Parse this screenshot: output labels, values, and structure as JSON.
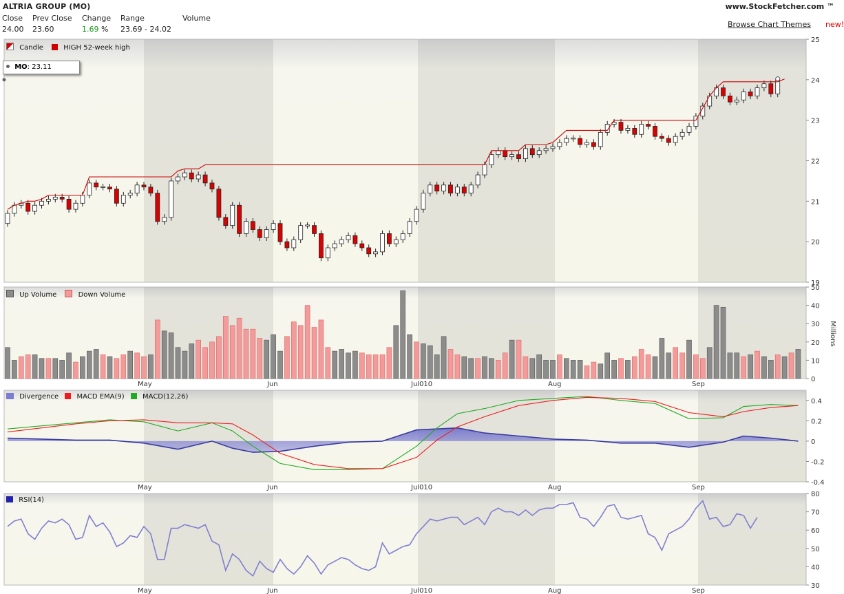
{
  "header": {
    "title": "ALTRIA GROUP (MO)",
    "labels": {
      "close": "Close",
      "prev_close": "Prev Close",
      "change": "Change",
      "range": "Range",
      "volume": "Volume"
    },
    "values": {
      "close": "24.00",
      "prev_close": "23.60",
      "change": "1.69",
      "change_unit": "%",
      "range": "23.69 - 24.02"
    },
    "brand": "www.StockFetcher.com ™",
    "browse_link": "Browse Chart Themes",
    "new_badge": "new!"
  },
  "colors": {
    "up_candle": "#ffffff",
    "down_candle": "#dd0000",
    "high52": "#cc0000",
    "up_volume": "#8c8c8c",
    "down_volume": "#f39a9a",
    "divergence": "#7c7cd0",
    "macd_ema": "#ee1c1c",
    "macd": "#22aa22",
    "rsi": "#7f7fd0"
  },
  "tooltip": {
    "symbol": "MO",
    "value": "23.11"
  },
  "chart_data": [
    {
      "type": "candlestick",
      "legend": [
        "Candle",
        "HIGH 52-week high"
      ],
      "ylim": [
        19,
        25
      ],
      "yticks": [
        "19",
        "20",
        "21",
        "22",
        "23",
        "24",
        "25"
      ],
      "xticks": [
        "May",
        "Jun",
        "Jul010",
        "Aug",
        "Sep"
      ],
      "close": [
        20.7,
        20.9,
        20.95,
        20.75,
        20.9,
        21.0,
        21.05,
        21.1,
        21.05,
        20.8,
        20.95,
        21.15,
        21.45,
        21.35,
        21.35,
        21.3,
        20.95,
        21.15,
        21.2,
        21.4,
        21.35,
        21.2,
        20.5,
        20.6,
        21.5,
        21.6,
        21.7,
        21.55,
        21.65,
        21.45,
        21.3,
        20.6,
        20.4,
        20.9,
        20.2,
        20.5,
        20.3,
        20.1,
        20.3,
        20.45,
        20.0,
        19.85,
        20.05,
        20.4,
        20.4,
        20.2,
        19.6,
        19.85,
        19.95,
        20.05,
        20.15,
        19.95,
        19.85,
        19.7,
        19.75,
        20.2,
        19.95,
        20.05,
        20.2,
        20.5,
        20.8,
        21.2,
        21.4,
        21.25,
        21.4,
        21.2,
        21.35,
        21.2,
        21.4,
        21.65,
        21.9,
        22.15,
        22.25,
        22.1,
        22.15,
        22.05,
        22.3,
        22.15,
        22.25,
        22.3,
        22.35,
        22.45,
        22.55,
        22.55,
        22.4,
        22.45,
        22.35,
        22.7,
        22.9,
        22.95,
        22.75,
        22.8,
        22.65,
        22.9,
        22.85,
        22.6,
        22.55,
        22.45,
        22.6,
        22.7,
        22.85,
        23.1,
        23.35,
        23.6,
        23.8,
        23.6,
        23.45,
        23.5,
        23.7,
        23.6,
        23.8,
        23.9,
        23.65,
        24.0
      ],
      "high_52week": [
        20.8,
        20.9,
        20.95,
        21.0,
        21.0,
        21.05,
        21.15,
        21.15,
        21.15,
        21.15,
        21.15,
        21.15,
        21.6,
        21.6,
        21.6,
        21.6,
        21.6,
        21.6,
        21.6,
        21.6,
        21.6,
        21.6,
        21.6,
        21.6,
        21.6,
        21.75,
        21.8,
        21.8,
        21.8,
        21.9,
        21.9,
        21.9,
        21.9,
        21.9,
        21.9,
        21.9,
        21.9,
        21.9,
        21.9,
        21.9,
        21.9,
        21.9,
        21.9,
        21.9,
        21.9,
        21.9,
        21.9,
        21.9,
        21.9,
        21.9,
        21.9,
        21.9,
        21.9,
        21.9,
        21.9,
        21.9,
        21.9,
        21.9,
        21.9,
        21.9,
        21.9,
        21.9,
        21.9,
        21.9,
        21.9,
        21.9,
        21.9,
        21.9,
        21.9,
        21.9,
        21.9,
        22.25,
        22.25,
        22.25,
        22.25,
        22.25,
        22.4,
        22.4,
        22.4,
        22.4,
        22.45,
        22.6,
        22.75,
        22.75,
        22.75,
        22.75,
        22.75,
        22.75,
        22.75,
        23.0,
        23.0,
        23.0,
        23.0,
        23.0,
        23.0,
        23.0,
        23.0,
        23.0,
        23.0,
        23.0,
        23.0,
        23.0,
        23.3,
        23.6,
        23.8,
        23.95,
        23.95,
        23.95,
        23.95,
        23.95,
        23.95,
        23.95,
        23.95,
        23.95,
        24.02
      ]
    },
    {
      "type": "bar",
      "legend": [
        "Up Volume",
        "Down Volume"
      ],
      "ylabel": "Millions",
      "ylim": [
        0,
        50
      ],
      "yticks": [
        "0",
        "10",
        "20",
        "30",
        "40",
        "50"
      ],
      "volume": [
        17,
        10,
        12,
        13,
        13,
        11,
        11,
        11,
        10,
        14,
        9,
        12,
        15,
        16,
        13,
        12,
        11,
        13,
        15,
        14,
        12,
        13,
        32,
        26,
        25,
        17,
        15,
        19,
        21,
        17,
        20,
        23,
        34,
        29,
        33,
        27,
        27,
        22,
        21,
        24,
        15,
        23,
        31,
        29,
        40,
        28,
        32,
        17,
        15,
        16,
        14,
        15,
        14,
        13,
        13,
        13,
        17,
        29,
        48,
        24,
        20,
        19,
        18,
        13,
        23,
        16,
        13,
        12,
        11,
        11,
        12,
        11,
        10,
        14,
        21,
        21,
        12,
        11,
        13,
        10,
        10,
        13,
        11,
        10,
        10,
        7,
        9,
        8,
        14,
        10,
        11,
        10,
        12,
        16,
        13,
        12,
        22,
        14,
        17,
        14,
        21,
        13,
        11,
        17,
        40,
        39,
        14,
        14,
        12,
        13,
        15,
        12,
        10,
        13,
        12,
        14,
        16
      ],
      "direction": [
        "u",
        "u",
        "d",
        "d",
        "u",
        "u",
        "d",
        "u",
        "u",
        "u",
        "d",
        "u",
        "u",
        "u",
        "d",
        "u",
        "d",
        "d",
        "u",
        "d",
        "d",
        "u",
        "d",
        "u",
        "u",
        "u",
        "u",
        "u",
        "d",
        "d",
        "d",
        "d",
        "d",
        "d",
        "d",
        "d",
        "d",
        "d",
        "u",
        "u",
        "u",
        "d",
        "d",
        "d",
        "d",
        "d",
        "d",
        "d",
        "u",
        "u",
        "u",
        "u",
        "d",
        "d",
        "d",
        "d",
        "d",
        "u",
        "u",
        "u",
        "d",
        "u",
        "u",
        "u",
        "u",
        "d",
        "d",
        "u",
        "u",
        "d",
        "u",
        "u",
        "d",
        "d",
        "u",
        "d",
        "d",
        "u",
        "u",
        "u",
        "u",
        "d",
        "u",
        "u",
        "u",
        "d",
        "d",
        "u",
        "u",
        "u",
        "d",
        "u",
        "d",
        "d",
        "d",
        "u",
        "u",
        "u",
        "d",
        "d",
        "u",
        "d",
        "d",
        "u",
        "u",
        "u",
        "u",
        "u",
        "d",
        "u",
        "d",
        "u",
        "u",
        "d",
        "u",
        "d",
        "u"
      ]
    },
    {
      "type": "line",
      "legend": [
        "Divergence",
        "MACD EMA(9)",
        "MACD(12,26)"
      ],
      "ylim": [
        -0.4,
        0.5
      ],
      "yticks": [
        "-0.4",
        "-0.2",
        "0",
        "0.2",
        "0.4"
      ],
      "series": [
        {
          "name": "MACD(12,26)",
          "x": [
            0,
            5,
            10,
            15,
            20,
            25,
            30,
            33,
            36,
            40,
            45,
            50,
            55,
            60,
            63,
            66,
            70,
            75,
            80,
            85,
            90,
            95,
            100,
            105,
            108,
            112,
            116
          ],
          "values": [
            0.12,
            0.15,
            0.18,
            0.21,
            0.19,
            0.1,
            0.18,
            0.1,
            -0.05,
            -0.22,
            -0.28,
            -0.28,
            -0.27,
            -0.05,
            0.13,
            0.27,
            0.32,
            0.4,
            0.42,
            0.44,
            0.4,
            0.37,
            0.22,
            0.23,
            0.34,
            0.36,
            0.35
          ]
        },
        {
          "name": "MACD EMA(9)",
          "x": [
            0,
            5,
            10,
            15,
            20,
            25,
            30,
            33,
            36,
            40,
            45,
            50,
            55,
            60,
            63,
            66,
            70,
            75,
            80,
            85,
            90,
            95,
            100,
            105,
            108,
            112,
            116
          ],
          "values": [
            0.09,
            0.13,
            0.17,
            0.2,
            0.21,
            0.18,
            0.18,
            0.17,
            0.06,
            -0.12,
            -0.23,
            -0.27,
            -0.27,
            -0.16,
            0.01,
            0.14,
            0.24,
            0.35,
            0.4,
            0.43,
            0.42,
            0.39,
            0.28,
            0.24,
            0.29,
            0.33,
            0.35
          ]
        },
        {
          "name": "Divergence",
          "x": [
            0,
            5,
            10,
            15,
            20,
            25,
            30,
            33,
            36,
            40,
            45,
            50,
            55,
            60,
            63,
            66,
            70,
            75,
            80,
            85,
            90,
            95,
            100,
            105,
            108,
            112,
            116
          ],
          "values": [
            0.03,
            0.02,
            0.01,
            0.01,
            -0.02,
            -0.08,
            0.0,
            -0.07,
            -0.11,
            -0.1,
            -0.05,
            -0.01,
            0.0,
            0.11,
            0.12,
            0.13,
            0.08,
            0.05,
            0.02,
            0.01,
            -0.02,
            -0.02,
            -0.06,
            -0.01,
            0.05,
            0.03,
            0.0
          ]
        }
      ]
    },
    {
      "type": "line",
      "legend": [
        "RSI(14)"
      ],
      "ylim": [
        30,
        80
      ],
      "yticks": [
        "30",
        "40",
        "50",
        "60",
        "70",
        "80"
      ],
      "xticks": [
        "May",
        "Jun",
        "Jul010",
        "Aug",
        "Sep"
      ],
      "series": [
        {
          "name": "RSI(14)",
          "values": [
            62,
            65,
            66,
            58,
            55,
            61,
            65,
            64,
            66,
            63,
            55,
            56,
            68,
            62,
            64,
            59,
            51,
            53,
            57,
            56,
            62,
            58,
            44,
            44,
            61,
            61,
            63,
            62,
            61,
            63,
            54,
            52,
            38,
            47,
            44,
            38,
            35,
            43,
            39,
            37,
            44,
            39,
            36,
            40,
            46,
            42,
            36,
            41,
            43,
            45,
            44,
            41,
            39,
            38,
            40,
            53,
            47,
            49,
            51,
            52,
            58,
            62,
            66,
            65,
            66,
            67,
            67,
            63,
            65,
            67,
            63,
            70,
            72,
            70,
            70,
            68,
            71,
            68,
            71,
            72,
            72,
            74,
            74,
            75,
            67,
            66,
            62,
            67,
            73,
            74,
            67,
            66,
            67,
            68,
            58,
            56,
            49,
            58,
            60,
            62,
            66,
            72,
            76,
            66,
            67,
            62,
            63,
            69,
            68,
            61,
            67
          ]
        }
      ]
    }
  ]
}
